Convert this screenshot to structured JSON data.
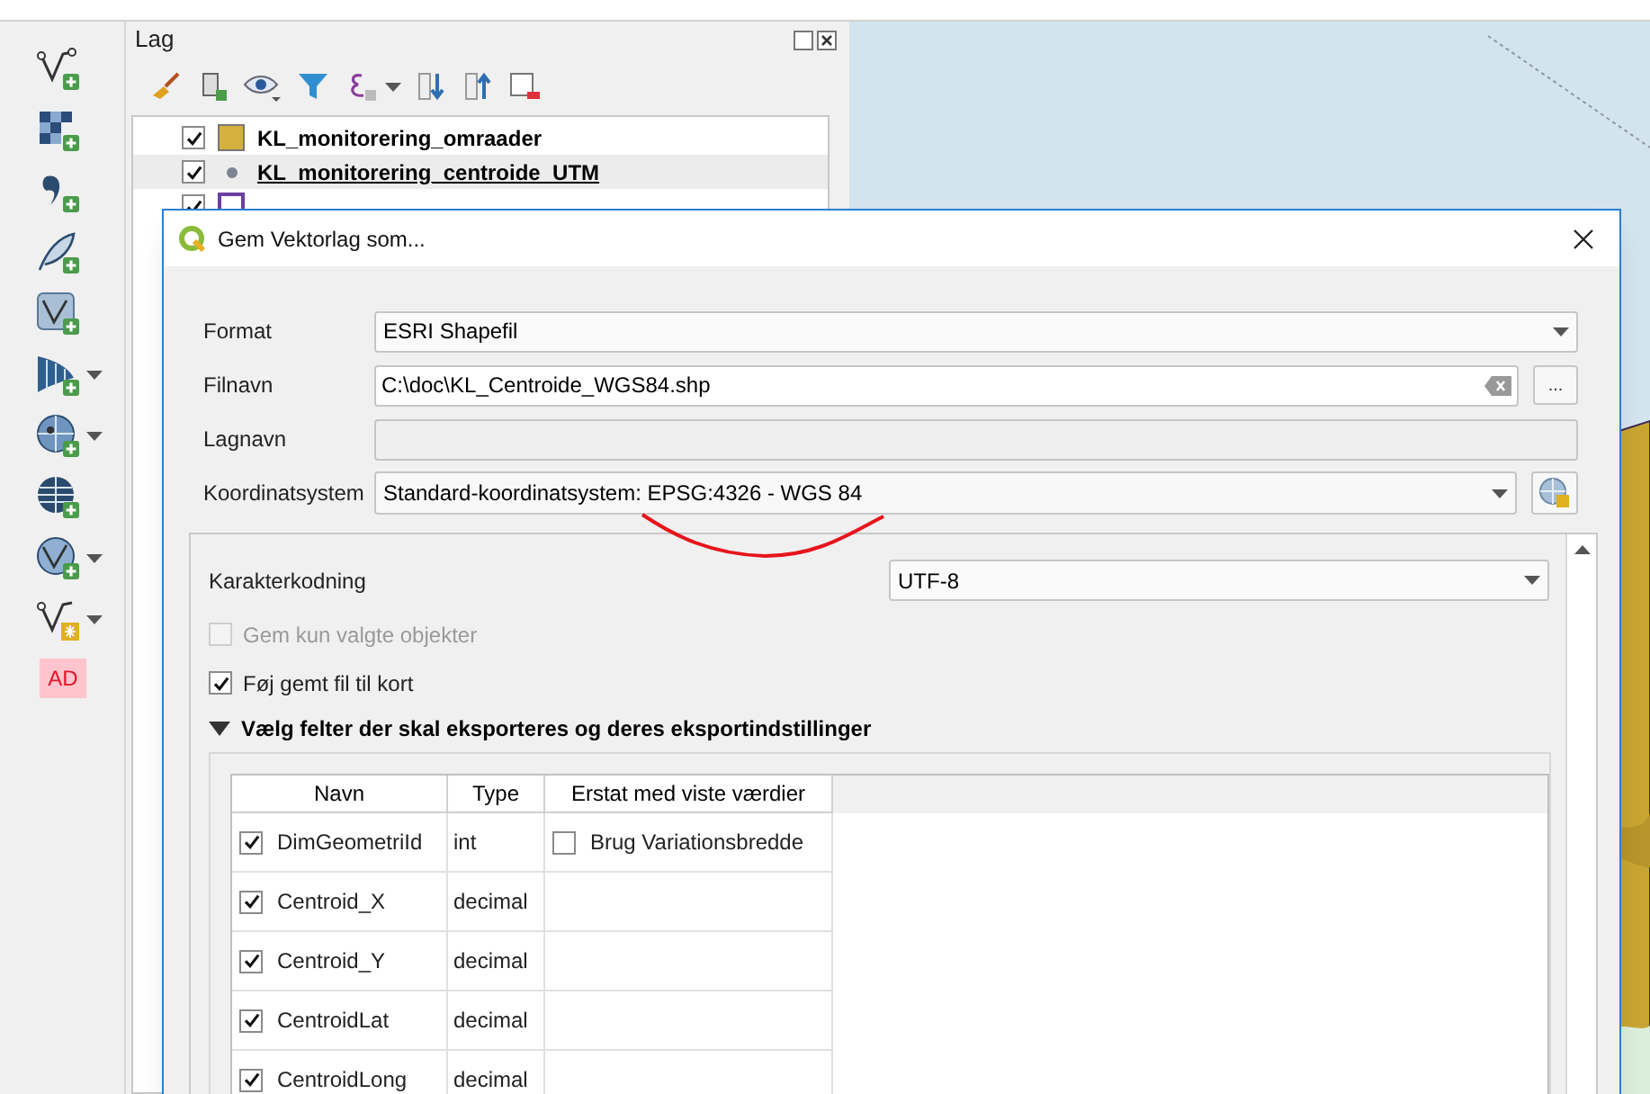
{
  "toolbar": {
    "items": [
      {
        "kind": "vector"
      },
      {
        "kind": "raster"
      },
      {
        "kind": "delimited"
      },
      {
        "kind": "feather"
      },
      {
        "kind": "vectorbox"
      },
      {
        "kind": "mesh",
        "menu": true
      },
      {
        "kind": "globepin",
        "menu": true
      },
      {
        "kind": "globe"
      },
      {
        "kind": "globevector",
        "menu": true
      },
      {
        "kind": "vectorstar",
        "menu": true
      },
      {
        "kind": "badge",
        "label": "AD"
      }
    ]
  },
  "layers_panel": {
    "title": "Lag",
    "layers": [
      {
        "name": "KL_monitorering_omraader",
        "checked": true,
        "kind": "fill",
        "color": "#d4b13c",
        "current": false
      },
      {
        "name": "KL_monitorering_centroide_UTM",
        "checked": true,
        "kind": "point",
        "color": "#7d8591",
        "current": true
      },
      {
        "checked": true,
        "kind": "outline",
        "color": "#6b3fa0",
        "current": false
      }
    ]
  },
  "dialog": {
    "title": "Gem Vektorlag som...",
    "format": {
      "label": "Format",
      "value": "ESRI Shapefil"
    },
    "filename": {
      "label": "Filnavn",
      "value": "C:\\doc\\KL_Centroide_WGS84.shp",
      "browse": "..."
    },
    "layer_name": {
      "label": "Lagnavn",
      "disabled": true
    },
    "crs": {
      "label": "Koordinatsystem",
      "value": "Standard-koordinatsystem: EPSG:4326 - WGS 84"
    },
    "encoding": {
      "label": "Karakterkodning",
      "value": "UTF-8"
    },
    "options": [
      {
        "label": "Gem kun valgte objekter",
        "checked": false,
        "disabled": true
      },
      {
        "label": "Føj gemt fil til kort",
        "checked": true,
        "disabled": false
      }
    ],
    "fields_group": {
      "title": "Vælg felter der skal eksporteres og deres eksportindstillinger",
      "expanded": true,
      "columns": [
        "Navn",
        "Type",
        "Erstat med viste værdier"
      ],
      "rows": [
        {
          "name": "DimGeometriId",
          "checked": true,
          "type": "int",
          "replace": {
            "label": "Brug Variationsbredde",
            "checked": false
          }
        },
        {
          "name": "Centroid_X",
          "checked": true,
          "type": "decimal"
        },
        {
          "name": "Centroid_Y",
          "checked": true,
          "type": "decimal"
        },
        {
          "name": "CentroidLat",
          "checked": true,
          "type": "decimal"
        },
        {
          "name": "CentroidLong",
          "checked": true,
          "type": "decimal"
        }
      ]
    }
  }
}
